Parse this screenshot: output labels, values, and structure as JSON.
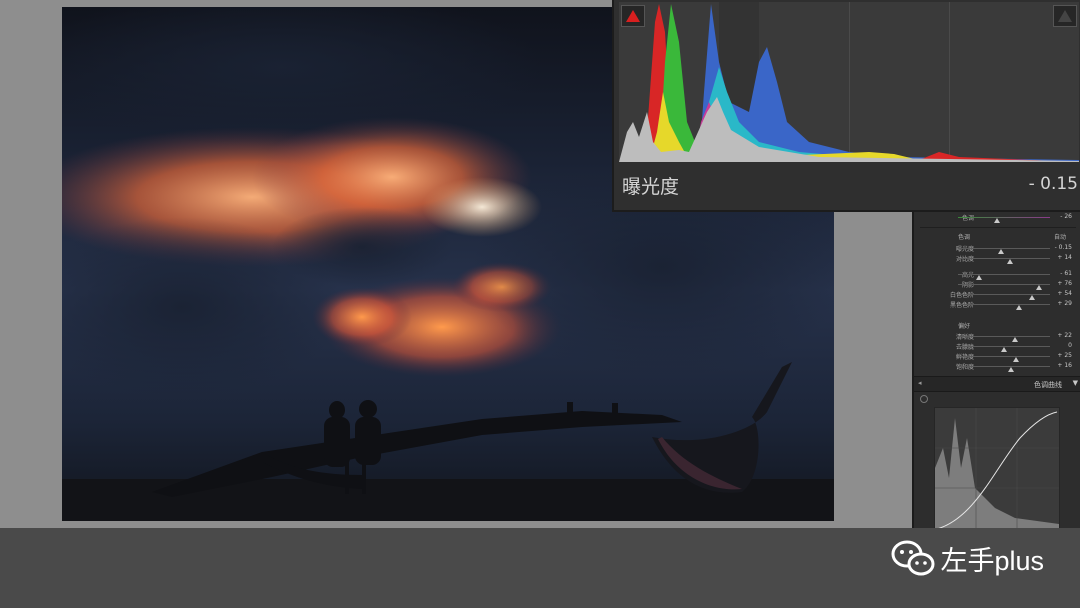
{
  "histogram": {
    "parameter_label": "曝光度",
    "parameter_value": "- 0.15",
    "clip_shadow_icon": "shadow-clipping-triangle",
    "clip_highlight_icon": "highlight-clipping-triangle"
  },
  "panel": {
    "top_slider": {
      "label": "色调",
      "value": "- 26",
      "pos": 0.42
    },
    "tone": {
      "section_label": "色调",
      "auto_label": "自动",
      "sliders": [
        {
          "label": "曝光度",
          "value": "- 0.15",
          "pos": 0.47
        },
        {
          "label": "对比度",
          "value": "+ 14",
          "pos": 0.56
        },
        {
          "label": "高光",
          "value": "- 61",
          "pos": 0.23
        },
        {
          "label": "阴影",
          "value": "+ 76",
          "pos": 0.88
        },
        {
          "label": "白色色阶",
          "value": "+ 54",
          "pos": 0.8
        },
        {
          "label": "黑色色阶",
          "value": "+ 29",
          "pos": 0.66
        }
      ]
    },
    "presence": {
      "section_label": "偏好",
      "sliders": [
        {
          "label": "清晰度",
          "value": "+ 22",
          "pos": 0.62
        },
        {
          "label": "去朦胧",
          "value": "0",
          "pos": 0.5
        },
        {
          "label": "鲜艳度",
          "value": "+ 25",
          "pos": 0.63
        },
        {
          "label": "饱和度",
          "value": "+ 16",
          "pos": 0.58
        }
      ]
    },
    "curve_section_label": "色调曲线"
  },
  "brand": {
    "name": "左手plus",
    "icon": "wechat-icon"
  },
  "colors": {
    "accent_red": "#d81f1f",
    "panel_bg": "#2d2d2d",
    "bar_bg": "#4a4a4a"
  }
}
